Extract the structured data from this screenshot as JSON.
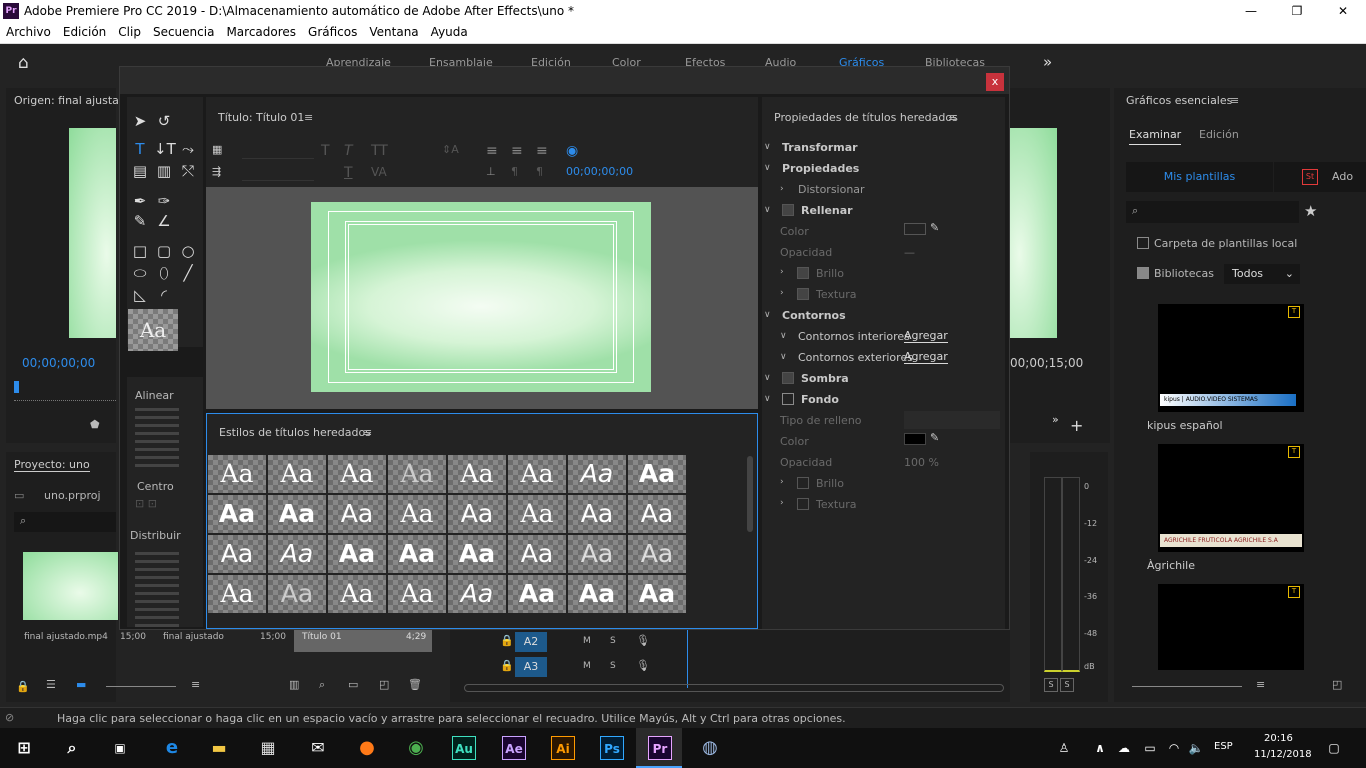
{
  "window": {
    "title": "Adobe Premiere Pro CC 2019 - D:\\Almacenamiento automático de Adobe After Effects\\uno *",
    "app_badge": "Pr",
    "minimize": "—",
    "restore": "❐",
    "close": "✕"
  },
  "menu": [
    "Archivo",
    "Edición",
    "Clip",
    "Secuencia",
    "Marcadores",
    "Gráficos",
    "Ventana",
    "Ayuda"
  ],
  "workspaces": [
    "Aprendizaje",
    "Ensamblaje",
    "Edición",
    "Color",
    "Efectos",
    "Audio",
    "Gráficos",
    "Bibliotecas"
  ],
  "source": {
    "title": "Origen: final ajustado",
    "timecode_left": "00;00;00;00",
    "timecode_right": "00;00;15;00"
  },
  "project": {
    "title": "Proyecto: uno",
    "file": "uno.prproj",
    "items": [
      {
        "name": "final ajustado.mp4",
        "dur": "15;00"
      },
      {
        "name": "final ajustado",
        "dur": "15;00"
      },
      {
        "name": "Título 01",
        "dur": "4;29"
      }
    ]
  },
  "title_dialog": {
    "title_panel": "Título: Título 01",
    "timecode": "00;00;00;00",
    "styles_panel": "Estilos de títulos heredados",
    "tools_labels": {
      "align": "Alinear",
      "center": "Centro",
      "distribute": "Distribuir"
    },
    "props_panel": "Propiedades de títulos heredados",
    "props": {
      "transformar": "Transformar",
      "propiedades": "Propiedades",
      "distorsionar": "Distorsionar",
      "rellenar": "Rellenar",
      "color": "Color",
      "opacidad": "Opacidad",
      "opacidad_val": "—",
      "brillo": "Brillo",
      "textura": "Textura",
      "contornos": "Contornos",
      "contornos_int": "Contornos interiores",
      "contornos_ext": "Contornos exteriores",
      "agregar": "Agregar",
      "sombra": "Sombra",
      "fondo": "Fondo",
      "tipo_relleno": "Tipo de relleno",
      "color2": "Color",
      "opacidad2": "Opacidad",
      "opacidad2_val": "100 %",
      "brillo2": "Brillo",
      "textura2": "Textura"
    },
    "close": "x",
    "style_sample": "Aa"
  },
  "essential": {
    "title": "Gráficos esenciales",
    "tab_browse": "Examinar",
    "tab_edit": "Edición",
    "my_templates": "Mis plantillas",
    "adobe_stock": "Ado",
    "stock_badge": "St",
    "local_folder": "Carpeta de plantillas local",
    "libraries": "Bibliotecas",
    "libraries_select": "Todos",
    "templates": [
      {
        "name": "kipus español",
        "banner": "kipus | AUDIO.VIDEO SISTEMAS"
      },
      {
        "name": "Àgrichile",
        "banner": "AGRICHILE FRUTICOLA AGRICHILE S.A"
      },
      {
        "name": "",
        "banner": ""
      }
    ]
  },
  "timeline": {
    "tracks": [
      "A2",
      "A3"
    ],
    "m": "M",
    "s": "S"
  },
  "meter": {
    "ticks": [
      "0",
      "-12",
      "-24",
      "-36",
      "-48",
      "dB"
    ],
    "s_labels": [
      "S",
      "S"
    ]
  },
  "status": "Haga clic para seleccionar o haga clic en un espacio vacío y arrastre para seleccionar el recuadro. Utilice Mayús, Alt y Ctrl para otras opciones.",
  "taskbar": {
    "apps": [
      "Au",
      "Ae",
      "Ai",
      "Ps",
      "Pr"
    ],
    "lang": "ESP",
    "time": "20:16",
    "date": "11/12/2018"
  },
  "colors": {
    "accent": "#2d8ceb",
    "close": "#c8323c",
    "canvas_bg": "#9fe0a8"
  }
}
